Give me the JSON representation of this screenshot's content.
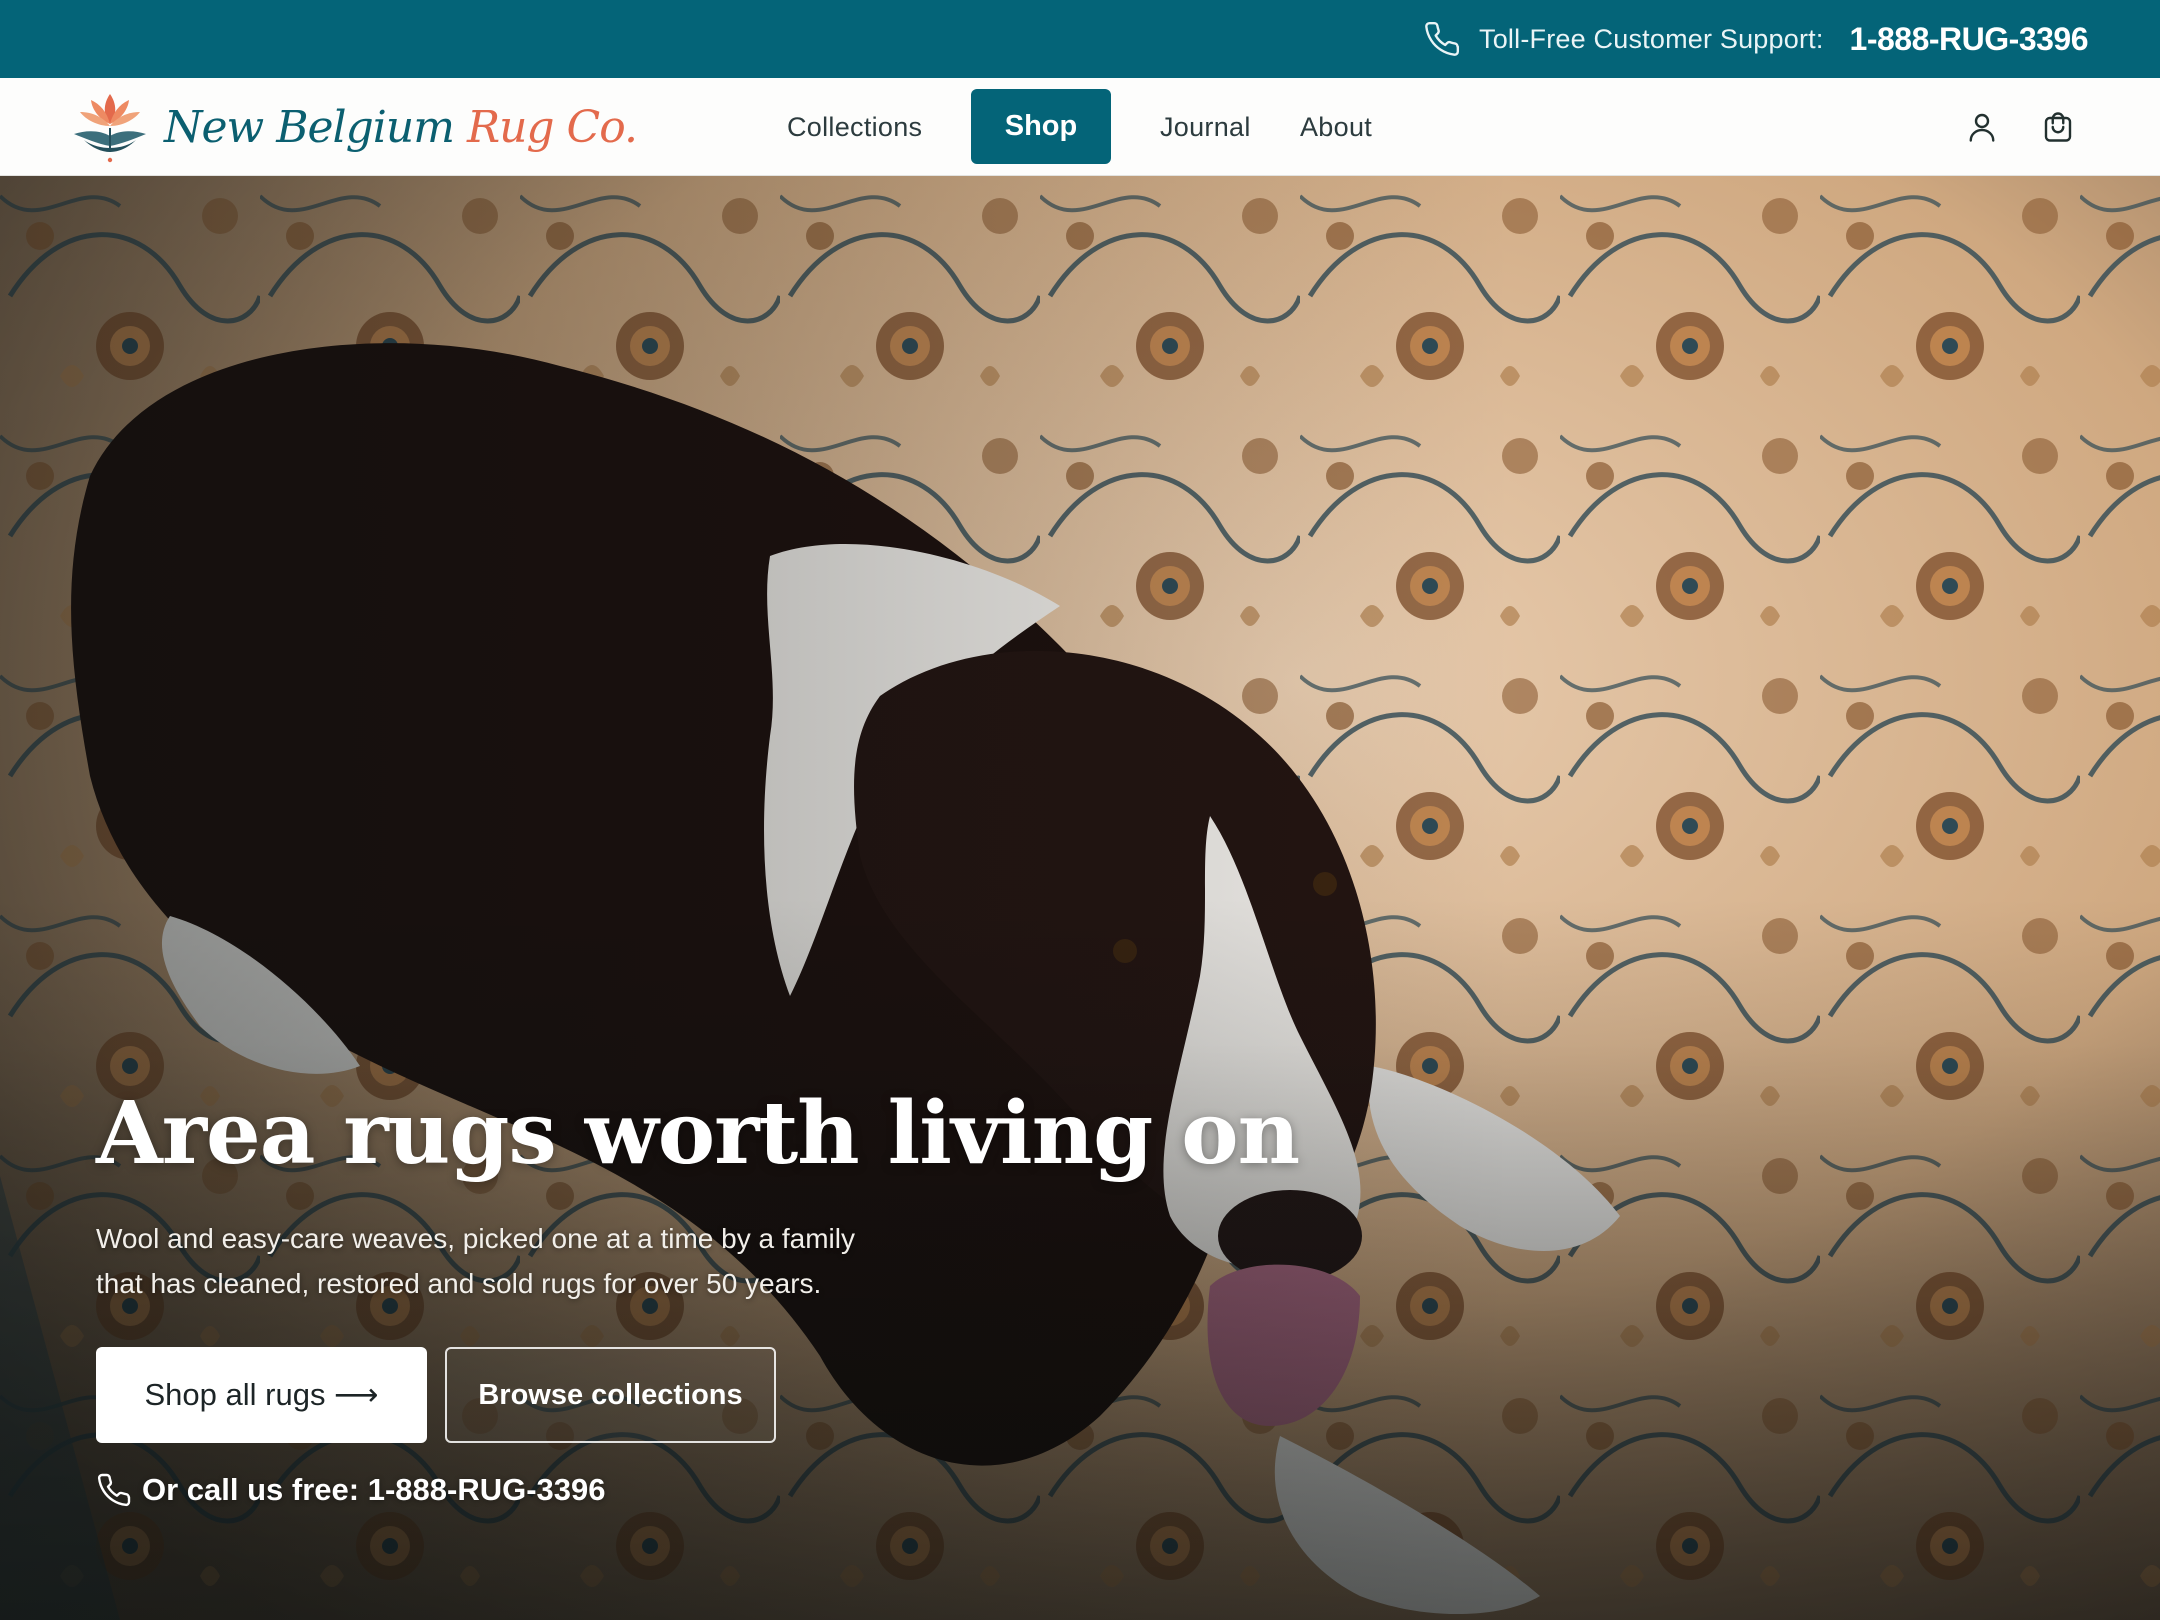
{
  "topbar": {
    "support_label": "Toll-Free Customer Support:",
    "support_number": "1-888-RUG-3396",
    "icon": "phone-icon",
    "bg_color": "#046478"
  },
  "brand": {
    "name_part1": "New Belgium",
    "name_part2": "Rug Co.",
    "logo_icon": "lotus-logo-icon",
    "teal": "#0b5f70",
    "orange": "#e36a4c"
  },
  "nav": {
    "items": [
      {
        "label": "Collections"
      },
      {
        "label": "Shop",
        "active": true
      },
      {
        "label": "Journal"
      },
      {
        "label": "About"
      }
    ],
    "account_icon": "user-icon",
    "cart_icon": "shopping-bag-icon"
  },
  "hero": {
    "title": "Area rugs worth living on",
    "subtitle_line1": "Wool and easy-care weaves, picked one at a time by a family",
    "subtitle_line2": "that has cleaned, restored and sold rugs for over 50 years.",
    "primary_cta": "Shop all rugs ⟶",
    "secondary_cta": "Browse collections",
    "call_text": "Or call us free: 1-888-RUG-3396",
    "call_icon": "phone-icon",
    "image_subject": "dog-on-rug-photo"
  }
}
